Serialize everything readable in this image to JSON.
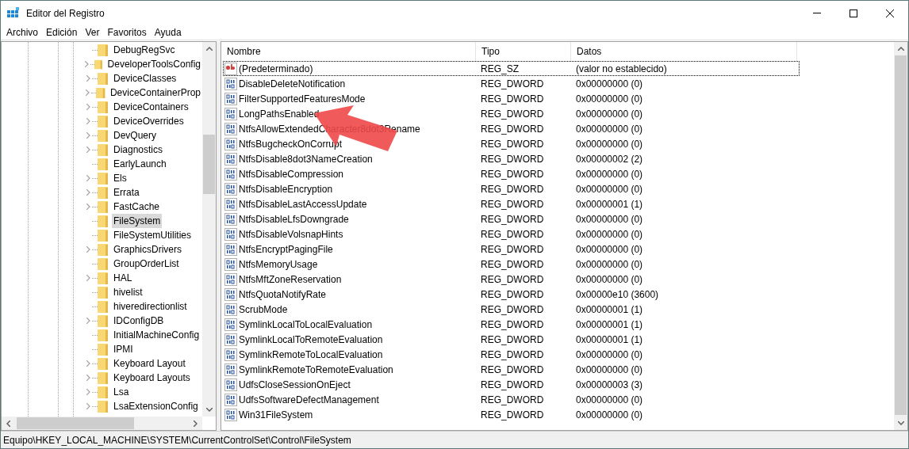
{
  "window": {
    "title": "Editor del Registro"
  },
  "menu": [
    {
      "label": "Archivo"
    },
    {
      "label": "Edición"
    },
    {
      "label": "Ver"
    },
    {
      "label": "Favoritos"
    },
    {
      "label": "Ayuda"
    }
  ],
  "tree": {
    "items": [
      {
        "label": "DebugRegSvc",
        "expandable": false,
        "selected": false
      },
      {
        "label": "DeveloperToolsConfig",
        "expandable": true,
        "selected": false
      },
      {
        "label": "DeviceClasses",
        "expandable": true,
        "selected": false
      },
      {
        "label": "DeviceContainerProp",
        "expandable": true,
        "selected": false
      },
      {
        "label": "DeviceContainers",
        "expandable": true,
        "selected": false
      },
      {
        "label": "DeviceOverrides",
        "expandable": true,
        "selected": false
      },
      {
        "label": "DevQuery",
        "expandable": true,
        "selected": false
      },
      {
        "label": "Diagnostics",
        "expandable": true,
        "selected": false
      },
      {
        "label": "EarlyLaunch",
        "expandable": false,
        "selected": false
      },
      {
        "label": "Els",
        "expandable": true,
        "selected": false
      },
      {
        "label": "Errata",
        "expandable": true,
        "selected": false
      },
      {
        "label": "FastCache",
        "expandable": true,
        "selected": false
      },
      {
        "label": "FileSystem",
        "expandable": false,
        "selected": true
      },
      {
        "label": "FileSystemUtilities",
        "expandable": false,
        "selected": false
      },
      {
        "label": "GraphicsDrivers",
        "expandable": true,
        "selected": false
      },
      {
        "label": "GroupOrderList",
        "expandable": false,
        "selected": false
      },
      {
        "label": "HAL",
        "expandable": true,
        "selected": false
      },
      {
        "label": "hivelist",
        "expandable": false,
        "selected": false
      },
      {
        "label": "hiveredirectionlist",
        "expandable": false,
        "selected": false
      },
      {
        "label": "IDConfigDB",
        "expandable": true,
        "selected": false
      },
      {
        "label": "InitialMachineConfig",
        "expandable": false,
        "selected": false
      },
      {
        "label": "IPMI",
        "expandable": false,
        "selected": false
      },
      {
        "label": "Keyboard Layout",
        "expandable": true,
        "selected": false
      },
      {
        "label": "Keyboard Layouts",
        "expandable": true,
        "selected": false
      },
      {
        "label": "Lsa",
        "expandable": true,
        "selected": false
      },
      {
        "label": "LsaExtensionConfig",
        "expandable": true,
        "selected": false
      }
    ]
  },
  "table": {
    "columns": [
      "Nombre",
      "Tipo",
      "Datos"
    ],
    "rows": [
      {
        "kind": "string",
        "name": "(Predeterminado)",
        "type": "REG_SZ",
        "data": "(valor no establecido)",
        "selected": true
      },
      {
        "kind": "dword",
        "name": "DisableDeleteNotification",
        "type": "REG_DWORD",
        "data": "0x00000000 (0)",
        "selected": false
      },
      {
        "kind": "dword",
        "name": "FilterSupportedFeaturesMode",
        "type": "REG_DWORD",
        "data": "0x00000000 (0)",
        "selected": false
      },
      {
        "kind": "dword",
        "name": "LongPathsEnabled",
        "type": "REG_DWORD",
        "data": "0x00000000 (0)",
        "selected": false
      },
      {
        "kind": "dword",
        "name": "NtfsAllowExtendedCharacter8dot3Rename",
        "type": "REG_DWORD",
        "data": "0x00000000 (0)",
        "selected": false
      },
      {
        "kind": "dword",
        "name": "NtfsBugcheckOnCorrupt",
        "type": "REG_DWORD",
        "data": "0x00000000 (0)",
        "selected": false
      },
      {
        "kind": "dword",
        "name": "NtfsDisable8dot3NameCreation",
        "type": "REG_DWORD",
        "data": "0x00000002 (2)",
        "selected": false
      },
      {
        "kind": "dword",
        "name": "NtfsDisableCompression",
        "type": "REG_DWORD",
        "data": "0x00000000 (0)",
        "selected": false
      },
      {
        "kind": "dword",
        "name": "NtfsDisableEncryption",
        "type": "REG_DWORD",
        "data": "0x00000000 (0)",
        "selected": false
      },
      {
        "kind": "dword",
        "name": "NtfsDisableLastAccessUpdate",
        "type": "REG_DWORD",
        "data": "0x00000001 (1)",
        "selected": false
      },
      {
        "kind": "dword",
        "name": "NtfsDisableLfsDowngrade",
        "type": "REG_DWORD",
        "data": "0x00000000 (0)",
        "selected": false
      },
      {
        "kind": "dword",
        "name": "NtfsDisableVolsnapHints",
        "type": "REG_DWORD",
        "data": "0x00000000 (0)",
        "selected": false
      },
      {
        "kind": "dword",
        "name": "NtfsEncryptPagingFile",
        "type": "REG_DWORD",
        "data": "0x00000000 (0)",
        "selected": false
      },
      {
        "kind": "dword",
        "name": "NtfsMemoryUsage",
        "type": "REG_DWORD",
        "data": "0x00000000 (0)",
        "selected": false
      },
      {
        "kind": "dword",
        "name": "NtfsMftZoneReservation",
        "type": "REG_DWORD",
        "data": "0x00000000 (0)",
        "selected": false
      },
      {
        "kind": "dword",
        "name": "NtfsQuotaNotifyRate",
        "type": "REG_DWORD",
        "data": "0x00000e10 (3600)",
        "selected": false
      },
      {
        "kind": "dword",
        "name": "ScrubMode",
        "type": "REG_DWORD",
        "data": "0x00000001 (1)",
        "selected": false
      },
      {
        "kind": "dword",
        "name": "SymlinkLocalToLocalEvaluation",
        "type": "REG_DWORD",
        "data": "0x00000001 (1)",
        "selected": false
      },
      {
        "kind": "dword",
        "name": "SymlinkLocalToRemoteEvaluation",
        "type": "REG_DWORD",
        "data": "0x00000001 (1)",
        "selected": false
      },
      {
        "kind": "dword",
        "name": "SymlinkRemoteToLocalEvaluation",
        "type": "REG_DWORD",
        "data": "0x00000000 (0)",
        "selected": false
      },
      {
        "kind": "dword",
        "name": "SymlinkRemoteToRemoteEvaluation",
        "type": "REG_DWORD",
        "data": "0x00000000 (0)",
        "selected": false
      },
      {
        "kind": "dword",
        "name": "UdfsCloseSessionOnEject",
        "type": "REG_DWORD",
        "data": "0x00000003 (3)",
        "selected": false
      },
      {
        "kind": "dword",
        "name": "UdfsSoftwareDefectManagement",
        "type": "REG_DWORD",
        "data": "0x00000000 (0)",
        "selected": false
      },
      {
        "kind": "dword",
        "name": "Win31FileSystem",
        "type": "REG_DWORD",
        "data": "0x00000000 (0)",
        "selected": false
      }
    ]
  },
  "status_bar": "Equipo\\HKEY_LOCAL_MACHINE\\SYSTEM\\CurrentControlSet\\Control\\FileSystem"
}
